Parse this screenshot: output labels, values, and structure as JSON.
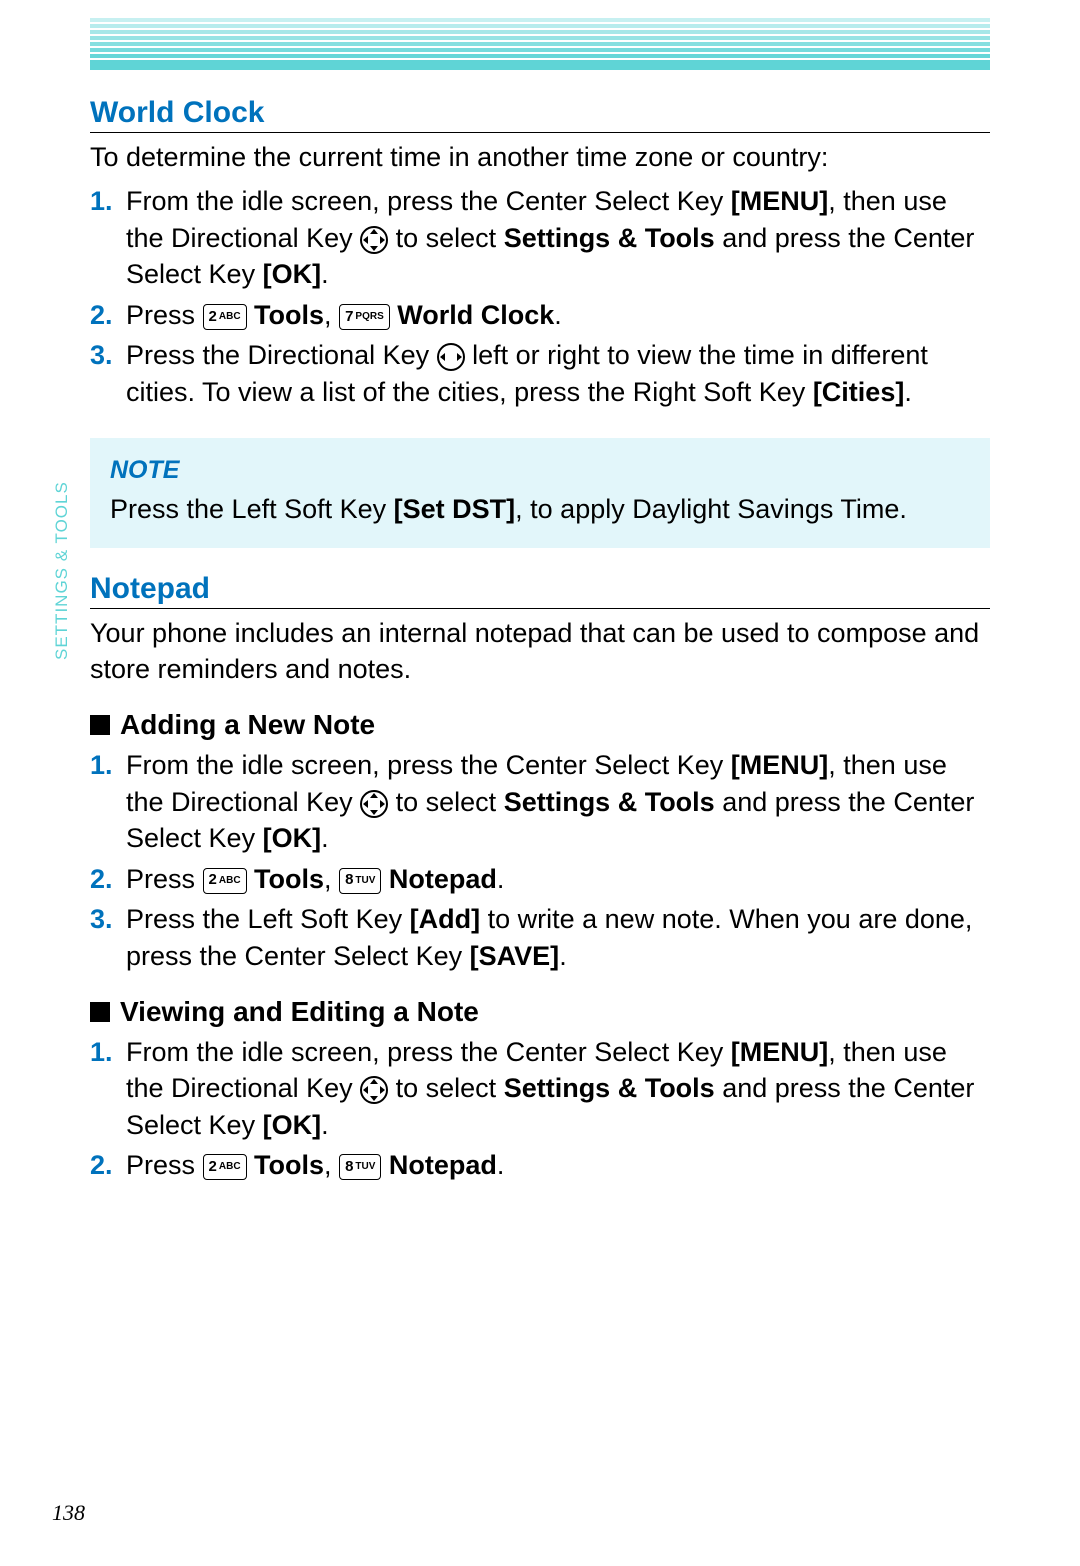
{
  "sideLabel": "SETTINGS & TOOLS",
  "pageNumber": "138",
  "worldClock": {
    "heading": "World Clock",
    "intro": "To determine the current time in another time zone or country:",
    "step1_a": "From the idle screen, press the Center Select Key ",
    "step1_menu": "[MENU]",
    "step1_b": ", then use the Directional Key ",
    "step1_c": " to select ",
    "step1_settings": "Settings & Tools",
    "step1_d": " and press the Center Select Key ",
    "step1_ok": "[OK]",
    "step1_e": ".",
    "step2_a": "Press ",
    "step2_tools": " Tools",
    "step2_b": ", ",
    "step2_wc": " World Clock",
    "step2_c": ".",
    "step3_a": "Press the Directional Key ",
    "step3_b": " left or right to view the time in different cities. To view a list of the cities, press the Right Soft Key ",
    "step3_cities": "[Cities]",
    "step3_c": ".",
    "key2": "2",
    "key2sub": "ABC",
    "key7": "7",
    "key7sub": "PQRS"
  },
  "note": {
    "title": "NOTE",
    "a": "Press the Left Soft Key ",
    "setdst": "[Set DST]",
    "b": ", to apply Daylight Savings Time."
  },
  "notepad": {
    "heading": "Notepad",
    "intro": "Your phone includes an internal notepad that can be used to compose and store reminders and notes.",
    "addHeading": "Adding a New Note",
    "viewHeading": "Viewing and Editing a Note",
    "step2_np": " Notepad",
    "key8": "8",
    "key8sub": "TUV",
    "add3_a": "Press the Left Soft Key ",
    "add3_add": "[Add]",
    "add3_b": " to write a new note. When you are done, press the Center Select Key ",
    "add3_save": "[SAVE]",
    "add3_c": "."
  }
}
